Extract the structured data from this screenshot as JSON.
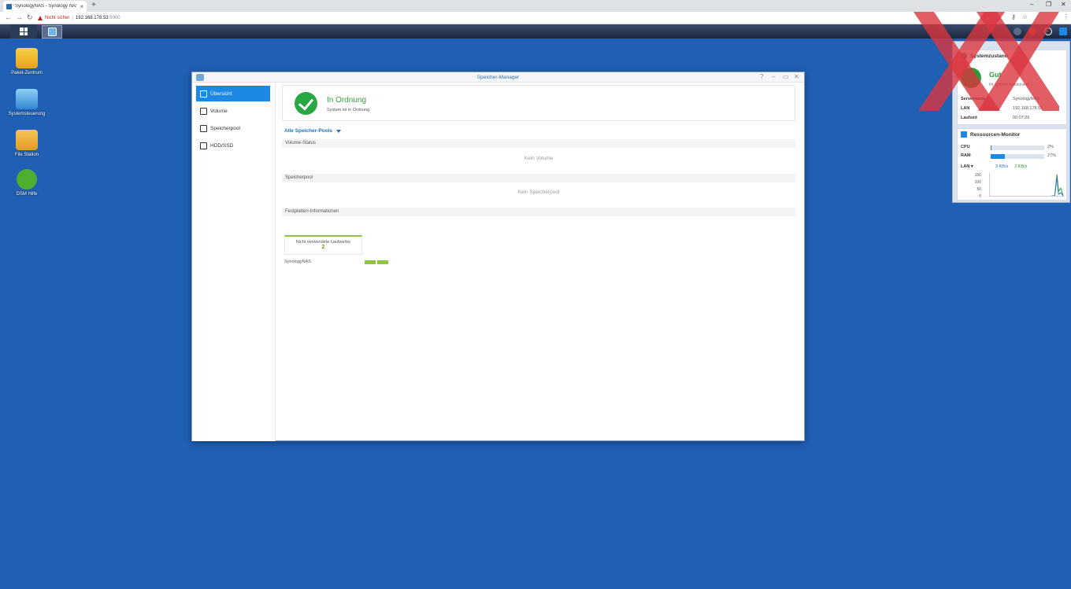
{
  "browser": {
    "tab_title": "SynologyNAS - Synology NAS",
    "tab_close": "×",
    "new_tab": "+",
    "security_label": "Nicht sicher",
    "separator": "|",
    "url_host": "192.168.178.53",
    "url_port": ":5000",
    "window_controls": {
      "minimize": "–",
      "restore": "❐",
      "close": "✕"
    },
    "nav": {
      "back": "←",
      "forward": "→",
      "reload": "↻"
    },
    "toolbar_icons": {
      "key": "⚷",
      "star": "☆",
      "menu": "⋮"
    }
  },
  "desktop": {
    "icons": [
      {
        "label": "Paket-Zentrum"
      },
      {
        "label": "Systemsteuerung"
      },
      {
        "label": "File Station"
      },
      {
        "label": "DSM Hilfe"
      }
    ]
  },
  "window": {
    "title": "Speicher-Manager",
    "buttons": {
      "help": "?",
      "minimize": "–",
      "maximize": "▭",
      "close": "✕"
    },
    "sidebar": [
      {
        "label": "Übersicht",
        "active": true
      },
      {
        "label": "Volume",
        "active": false
      },
      {
        "label": "Speicherpool",
        "active": false
      },
      {
        "label": "HDD/SSD",
        "active": false
      }
    ],
    "status": {
      "title": "In Ordnung",
      "subtitle": "System ist in Ordnung."
    },
    "pool_dropdown": "Alle Speicher-Pools",
    "sections": {
      "volume_status": "Volume-Status",
      "volume_empty": "Kein Volume",
      "pool": "Speicherpool",
      "pool_empty": "Kein Speicherpool",
      "disk_info": "Festplatten-Informationen"
    },
    "unused_drives": {
      "label": "Nicht verwendete Laufwerke",
      "count": "2"
    },
    "nas_name": "SynologyNAS",
    "disk_count": 2
  },
  "widgets": {
    "system_health": {
      "title": "Systemzustand",
      "status": "Gut",
      "subtitle": "Ihr System funktioniert ...",
      "rows": [
        {
          "key": "Servername",
          "value": "SynologyNAS"
        },
        {
          "key": "LAN",
          "value": "192.168.178.53"
        },
        {
          "key": "Laufzeit",
          "value": "00:07:26"
        }
      ]
    },
    "resource_monitor": {
      "title": "Ressourcen-Monitor",
      "cpu_label": "CPU",
      "cpu_pct": 2,
      "cpu_text": "2%",
      "ram_label": "RAM",
      "ram_pct": 27,
      "ram_text": "27%",
      "lan_label": "LAN ▾",
      "upload": "3 KB/s",
      "download": "2 KB/s",
      "y_ticks": [
        "150",
        "100",
        "50",
        "0"
      ]
    }
  },
  "colors": {
    "accent": "#1e88e5",
    "ok_green": "#29a743",
    "disk_green": "#8cc63f",
    "desktop_blue": "#1f5fb4"
  }
}
